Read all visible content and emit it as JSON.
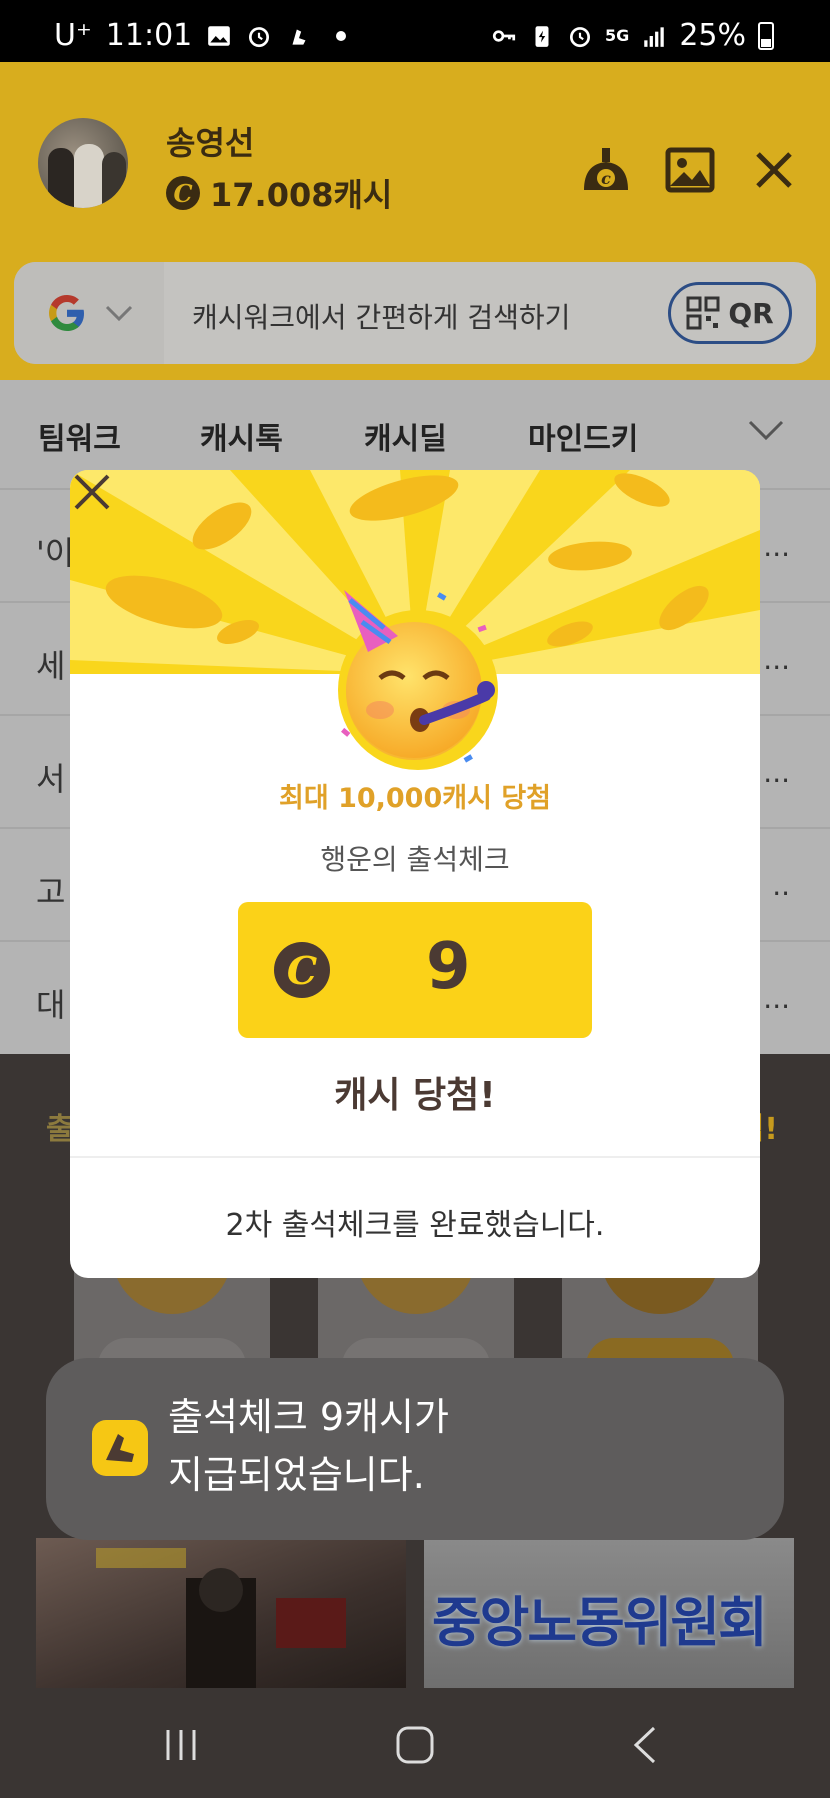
{
  "status_bar": {
    "carrier": "U⁺",
    "time": "11:01",
    "network": "5G",
    "battery": "25%"
  },
  "profile": {
    "name": "송영선",
    "cash": "17.008캐시"
  },
  "search": {
    "placeholder": "캐시워크에서 간편하게 검색하기",
    "qr_label": "QR"
  },
  "tabs": [
    "팀워크",
    "캐시톡",
    "캐시딜",
    "마인드키"
  ],
  "list_items": [
    {
      "start": "'이",
      "end": "..."
    },
    {
      "start": "세",
      "end": "..."
    },
    {
      "start": "서",
      "end": "|..."
    },
    {
      "start": "고",
      "end": ".."
    },
    {
      "start": "대",
      "end": "..."
    }
  ],
  "section": {
    "left_label": "출",
    "right_label": "첨!"
  },
  "photo_right_text": "중앙노동위원회",
  "modal": {
    "headline": "최대 10,000캐시 당첨",
    "subline": "행운의 출석체크",
    "coin_symbol": "C",
    "amount": "9",
    "result": "캐시 당첨!",
    "footer": "2차 출석체크를 완료했습니다."
  },
  "toast": {
    "line1": "출석체크 9캐시가",
    "line2": "지급되었습니다."
  },
  "colors": {
    "brand_yellow": "#f9d61c",
    "header_dimmed": "#d8ad1e",
    "accent_orange": "#e0a128",
    "coin_brown": "#4b3a33"
  },
  "icons": [
    "gallery-icon",
    "alarm-icon",
    "shoe-icon",
    "key-icon",
    "battery-saver-icon",
    "signal-icon",
    "cash-bell-icon",
    "image-icon",
    "close-icon",
    "google-icon",
    "chevron-down-icon",
    "qr-icon",
    "recent-apps-icon",
    "home-icon",
    "back-icon"
  ]
}
